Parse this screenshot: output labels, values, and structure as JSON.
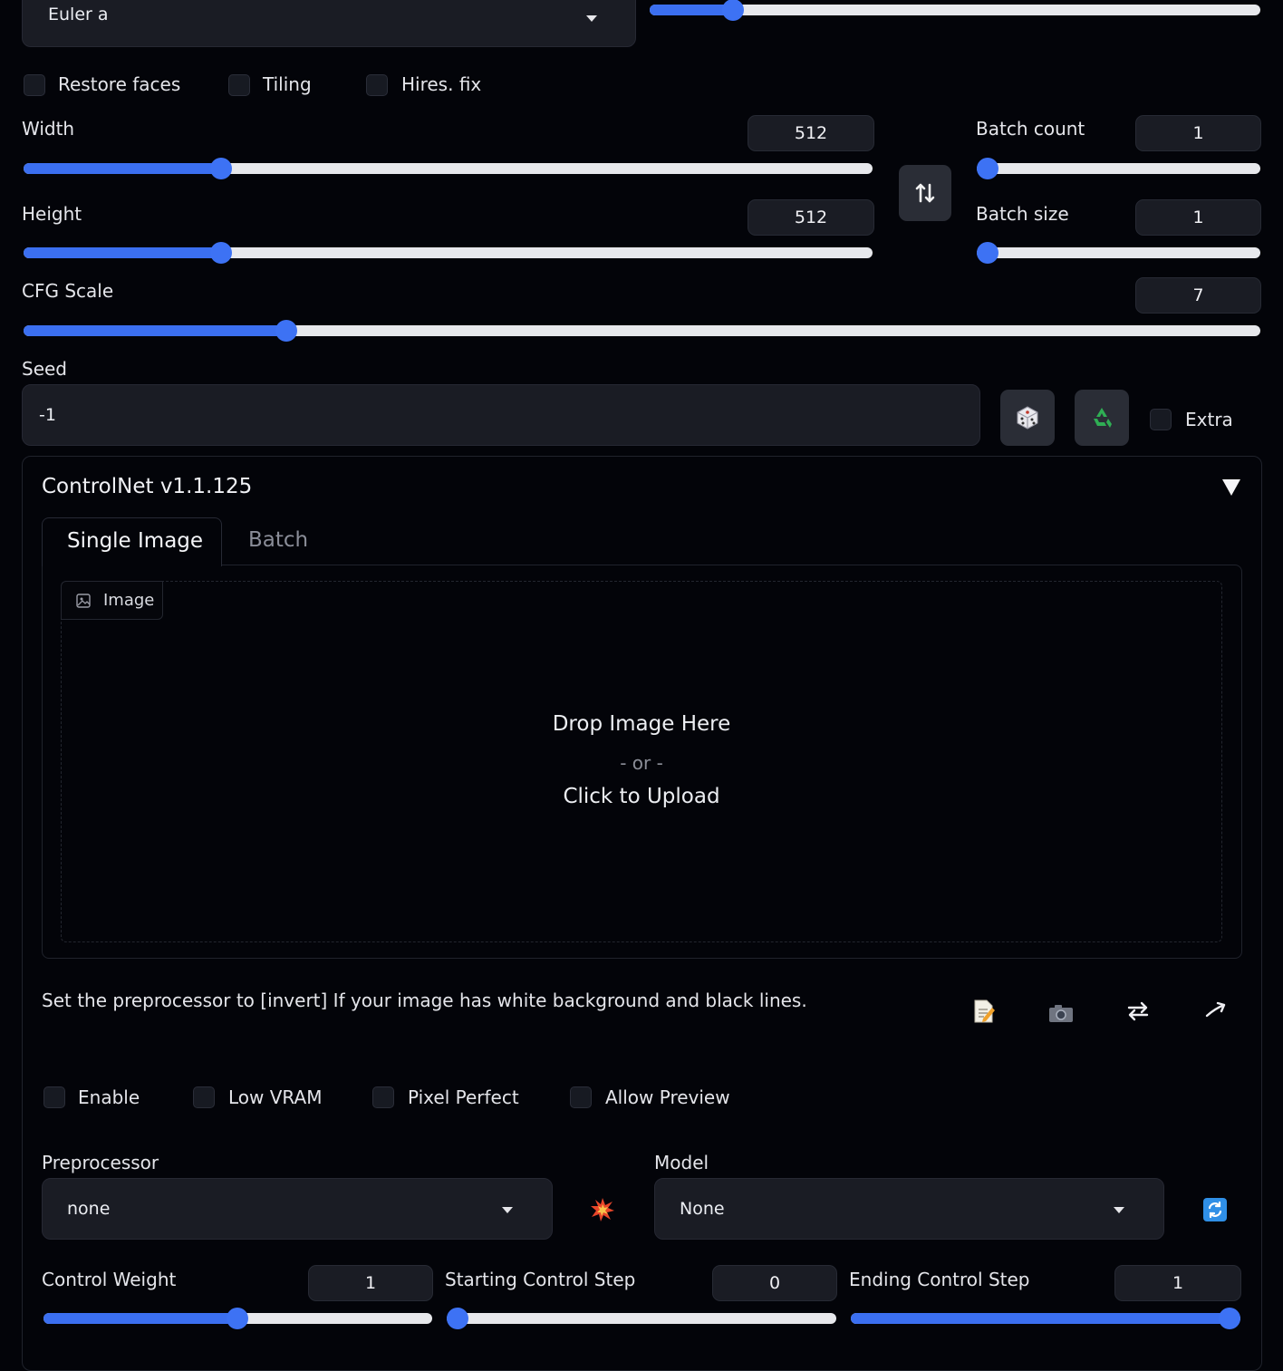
{
  "sampler": {
    "value": "Euler a",
    "steps_fraction": 0.117
  },
  "options": {
    "restore_faces": "Restore faces",
    "tiling": "Tiling",
    "hires_fix": "Hires. fix"
  },
  "width": {
    "label": "Width",
    "value": "512",
    "fraction": 0.233
  },
  "height": {
    "label": "Height",
    "value": "512",
    "fraction": 0.233
  },
  "batch_count": {
    "label": "Batch count",
    "value": "1",
    "fraction": 0.0
  },
  "batch_size": {
    "label": "Batch size",
    "value": "1",
    "fraction": 0.0
  },
  "cfg_scale": {
    "label": "CFG Scale",
    "value": "7",
    "fraction": 0.212
  },
  "seed": {
    "label": "Seed",
    "value": "-1",
    "extra_label": "Extra"
  },
  "controlnet": {
    "title": "ControlNet v1.1.125",
    "tabs": [
      "Single Image",
      "Batch"
    ],
    "image_label": "Image",
    "drop_text": "Drop Image Here",
    "or_text": "- or -",
    "upload_text": "Click to Upload",
    "hint": "Set the preprocessor to [invert] If your image has white background and black lines.",
    "checkboxes": {
      "enable": "Enable",
      "low_vram": "Low VRAM",
      "pixel_perfect": "Pixel Perfect",
      "allow_preview": "Allow Preview"
    },
    "preprocessor": {
      "label": "Preprocessor",
      "value": "none"
    },
    "model": {
      "label": "Model",
      "value": "None"
    },
    "control_weight": {
      "label": "Control Weight",
      "value": "1",
      "fraction": 0.5
    },
    "starting_step": {
      "label": "Starting Control Step",
      "value": "0",
      "fraction": 0.0
    },
    "ending_step": {
      "label": "Ending Control Step",
      "value": "1",
      "fraction": 1.0
    }
  },
  "colors": {
    "accent": "#3b6ff0",
    "background": "#030409",
    "input": "#1a1c24"
  },
  "icons": [
    "swap-dimensions-icon",
    "dice-icon",
    "recycle-icon",
    "collapse-triangle-icon",
    "image-icon",
    "edit-note-icon",
    "camera-icon",
    "swap-arrows-icon",
    "send-arrow-icon",
    "explosion-icon",
    "refresh-icon"
  ]
}
